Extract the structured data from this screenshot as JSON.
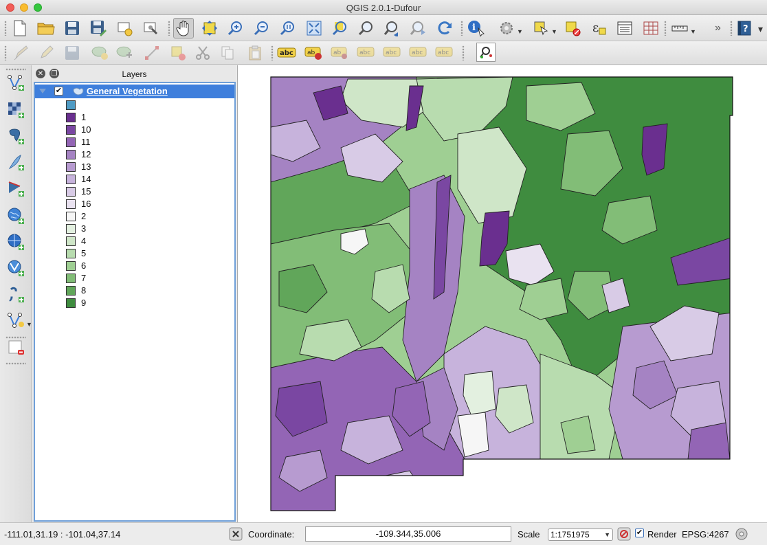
{
  "window": {
    "title": "QGIS 2.0.1-Dufour"
  },
  "toolbar_main": [
    {
      "name": "new-project-icon"
    },
    {
      "name": "open-project-icon"
    },
    {
      "name": "save-project-icon"
    },
    {
      "name": "save-as-icon"
    },
    {
      "name": "new-print-composer-icon"
    },
    {
      "name": "composer-manager-icon"
    },
    {
      "name": "pan-hand-icon"
    },
    {
      "name": "pan-to-selection-icon"
    },
    {
      "name": "zoom-in-icon"
    },
    {
      "name": "zoom-out-icon"
    },
    {
      "name": "zoom-actual-size-icon"
    },
    {
      "name": "zoom-full-icon"
    },
    {
      "name": "zoom-to-selection-icon"
    },
    {
      "name": "zoom-to-layer-icon"
    },
    {
      "name": "zoom-last-icon"
    },
    {
      "name": "zoom-next-icon"
    },
    {
      "name": "refresh-icon"
    },
    {
      "name": "identify-icon"
    },
    {
      "name": "run-action-icon"
    },
    {
      "name": "select-features-icon"
    },
    {
      "name": "deselect-icon"
    },
    {
      "name": "expression-select-icon"
    },
    {
      "name": "attribute-table-icon"
    },
    {
      "name": "statistics-icon"
    },
    {
      "name": "measure-line-icon"
    },
    {
      "name": "help-icon"
    }
  ],
  "toolbar_edit": [
    {
      "name": "current-edits-icon"
    },
    {
      "name": "toggle-editing-icon"
    },
    {
      "name": "save-edits-icon"
    },
    {
      "name": "add-feature-icon"
    },
    {
      "name": "move-feature-icon"
    },
    {
      "name": "node-tool-icon"
    },
    {
      "name": "delete-selected-icon"
    },
    {
      "name": "cut-features-icon"
    },
    {
      "name": "copy-features-icon"
    },
    {
      "name": "paste-features-icon"
    },
    {
      "name": "label-abc-icon"
    },
    {
      "name": "pin-labels-icon"
    },
    {
      "name": "show-hide-labels-icon"
    },
    {
      "name": "move-label-icon"
    },
    {
      "name": "rotate-label-icon"
    },
    {
      "name": "change-label-icon"
    },
    {
      "name": "label-properties-icon"
    },
    {
      "name": "map-tips-icon"
    }
  ],
  "toolbar_layers": [
    {
      "name": "add-vector-layer-icon"
    },
    {
      "name": "add-raster-layer-icon"
    },
    {
      "name": "add-postgis-layer-icon"
    },
    {
      "name": "add-spatialite-layer-icon"
    },
    {
      "name": "add-mssql-layer-icon"
    },
    {
      "name": "add-wms-layer-icon"
    },
    {
      "name": "add-wcs-layer-icon"
    },
    {
      "name": "add-wfs-layer-icon"
    },
    {
      "name": "add-delimited-text-icon"
    },
    {
      "name": "new-shapefile-layer-icon"
    },
    {
      "name": "remove-layer-icon"
    }
  ],
  "layers_panel": {
    "title": "Layers",
    "layer": {
      "name": "General Vegetation",
      "checked": true,
      "expanded": true
    },
    "legend": [
      {
        "label": "",
        "color": "#4f9bc4"
      },
      {
        "label": "1",
        "color": "#6a2f8f"
      },
      {
        "label": "10",
        "color": "#7a47a2"
      },
      {
        "label": "11",
        "color": "#9365b5"
      },
      {
        "label": "12",
        "color": "#a583c3"
      },
      {
        "label": "13",
        "color": "#b79bd0"
      },
      {
        "label": "14",
        "color": "#c7b3dc"
      },
      {
        "label": "15",
        "color": "#d8cbe6"
      },
      {
        "label": "16",
        "color": "#e9e2f0"
      },
      {
        "label": "2",
        "color": "#f6f6f6"
      },
      {
        "label": "3",
        "color": "#e3f0e0"
      },
      {
        "label": "4",
        "color": "#cfe6c8"
      },
      {
        "label": "5",
        "color": "#b8dcaf"
      },
      {
        "label": "6",
        "color": "#9fcf93"
      },
      {
        "label": "7",
        "color": "#82bd77"
      },
      {
        "label": "8",
        "color": "#61a65a"
      },
      {
        "label": "9",
        "color": "#3f8c3f"
      }
    ]
  },
  "status": {
    "extent": "-111.01,31.19 : -101.04,37.14",
    "coordinate_label": "Coordinate:",
    "coordinate_value": "-109.344,35.006",
    "scale_label": "Scale",
    "scale_value": "1:1751975",
    "render_label": "Render",
    "render_checked": true,
    "crs": "EPSG:4267"
  }
}
